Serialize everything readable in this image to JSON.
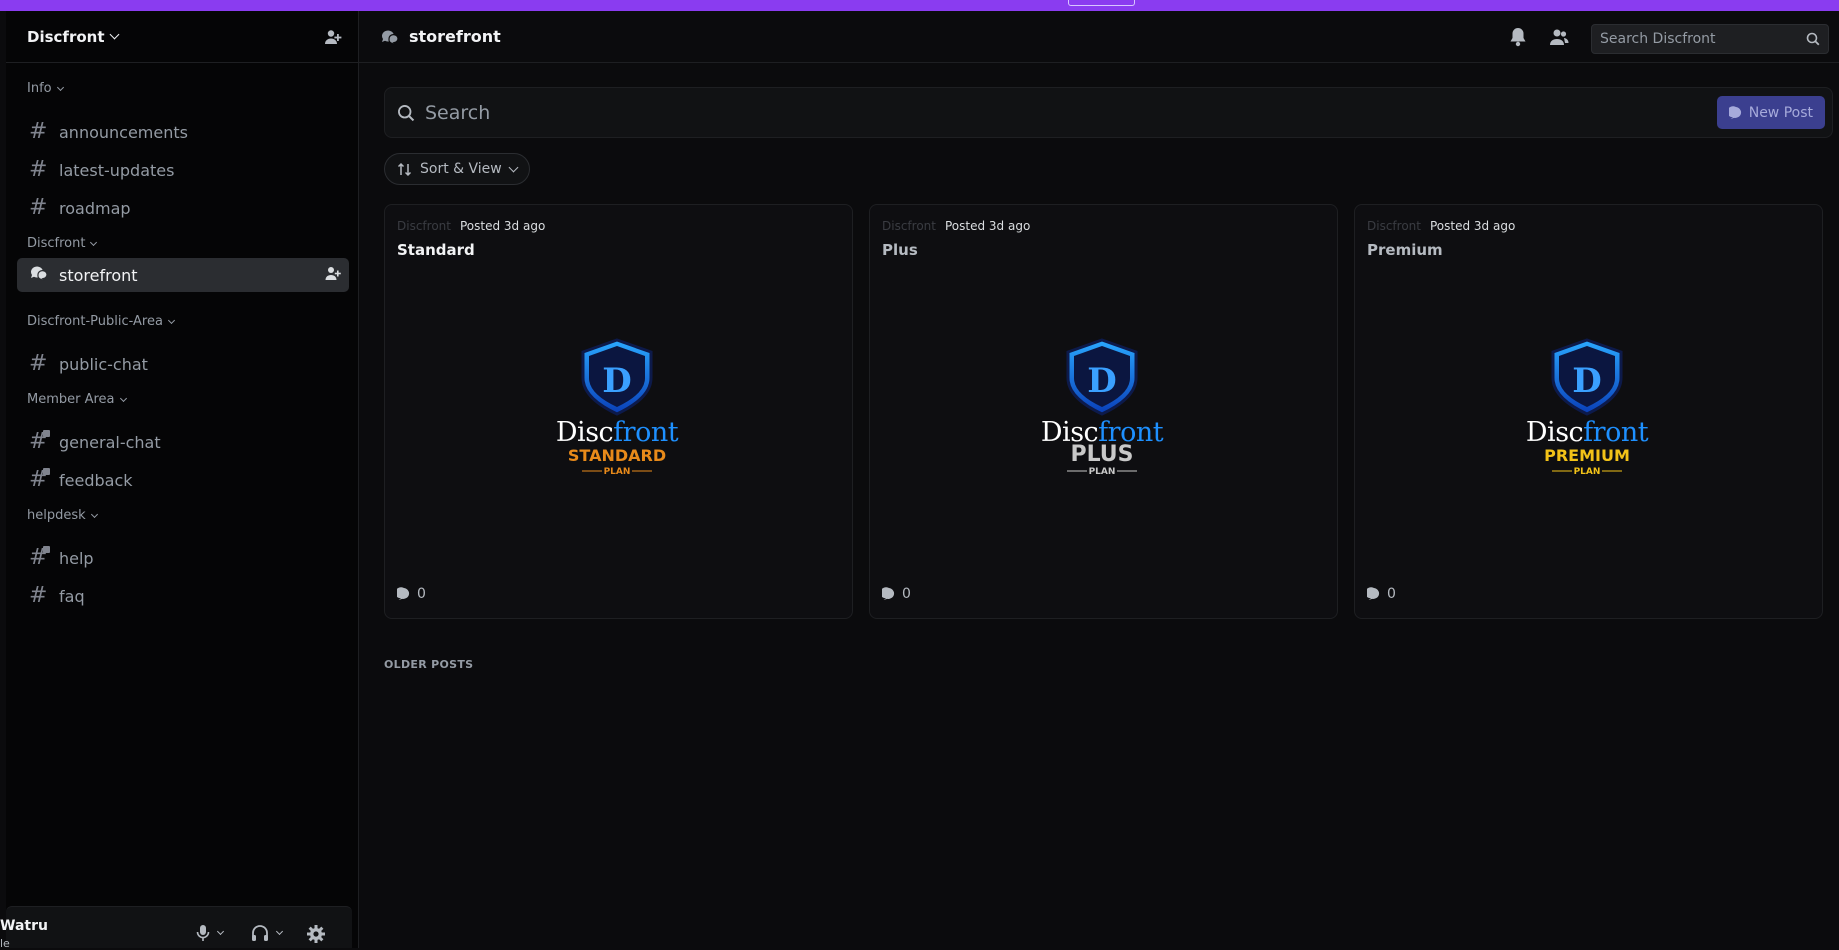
{
  "server": {
    "name": "Discfront"
  },
  "categories": [
    {
      "name": "Info",
      "channels": [
        "announcements",
        "latest-updates",
        "roadmap"
      ]
    },
    {
      "name": "Discfront",
      "channels": [
        "storefront"
      ]
    },
    {
      "name": "Discfront-Public-Area",
      "channels": [
        "public-chat"
      ]
    },
    {
      "name": "Member Area",
      "channels": [
        "general-chat",
        "feedback"
      ]
    },
    {
      "name": "helpdesk",
      "channels": [
        "help",
        "faq"
      ]
    }
  ],
  "user": {
    "name": "Watru",
    "status": "le"
  },
  "header": {
    "channel": "storefront",
    "search_placeholder": "Search Discfront"
  },
  "forum": {
    "search_placeholder": "Search",
    "new_post": "New Post",
    "sort_label": "Sort & View",
    "older_posts": "OLDER POSTS",
    "posts": [
      {
        "author": "Discfront",
        "posted": "Posted 3d ago",
        "title": "Standard",
        "brand_a": "Disc",
        "brand_b": "front",
        "plan": "STANDARD",
        "plan_sub": "PLAN",
        "comments": "0",
        "plan_color": "#e88a1a"
      },
      {
        "author": "Discfront",
        "posted": "Posted 3d ago",
        "title": "Plus",
        "brand_a": "Disc",
        "brand_b": "front",
        "plan": "PLUS",
        "plan_sub": "PLAN",
        "comments": "0",
        "plan_color": "#c8c8c8"
      },
      {
        "author": "Discfront",
        "posted": "Posted 3d ago",
        "title": "Premium",
        "brand_a": "Disc",
        "brand_b": "front",
        "plan": "PREMIUM",
        "plan_sub": "PLAN",
        "comments": "0",
        "plan_color": "#f2c218"
      }
    ]
  },
  "colors": {
    "accent": "#8a3cf0",
    "active_channel": "#2b2d31",
    "new_post_bg": "#3b3f8f",
    "brand_blue": "#1e90ff"
  }
}
